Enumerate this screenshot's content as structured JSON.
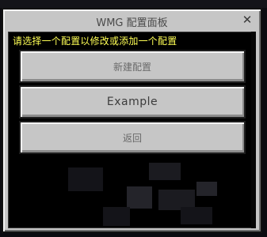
{
  "dialog": {
    "title": "WMG 配置面板",
    "close_label": "✕"
  },
  "panel": {
    "prompt": "请选择一个配置以修改或添加一个配置"
  },
  "buttons": [
    {
      "label": "新建配置"
    },
    {
      "label": "Example"
    },
    {
      "label": "返回"
    }
  ],
  "icons": {
    "close": "close-icon"
  },
  "colors": {
    "dialog_bg": "#c6c6c6",
    "panel_bg": "#000000",
    "prompt_text": "#ffff55",
    "button_bg": "#c6c6c6"
  }
}
